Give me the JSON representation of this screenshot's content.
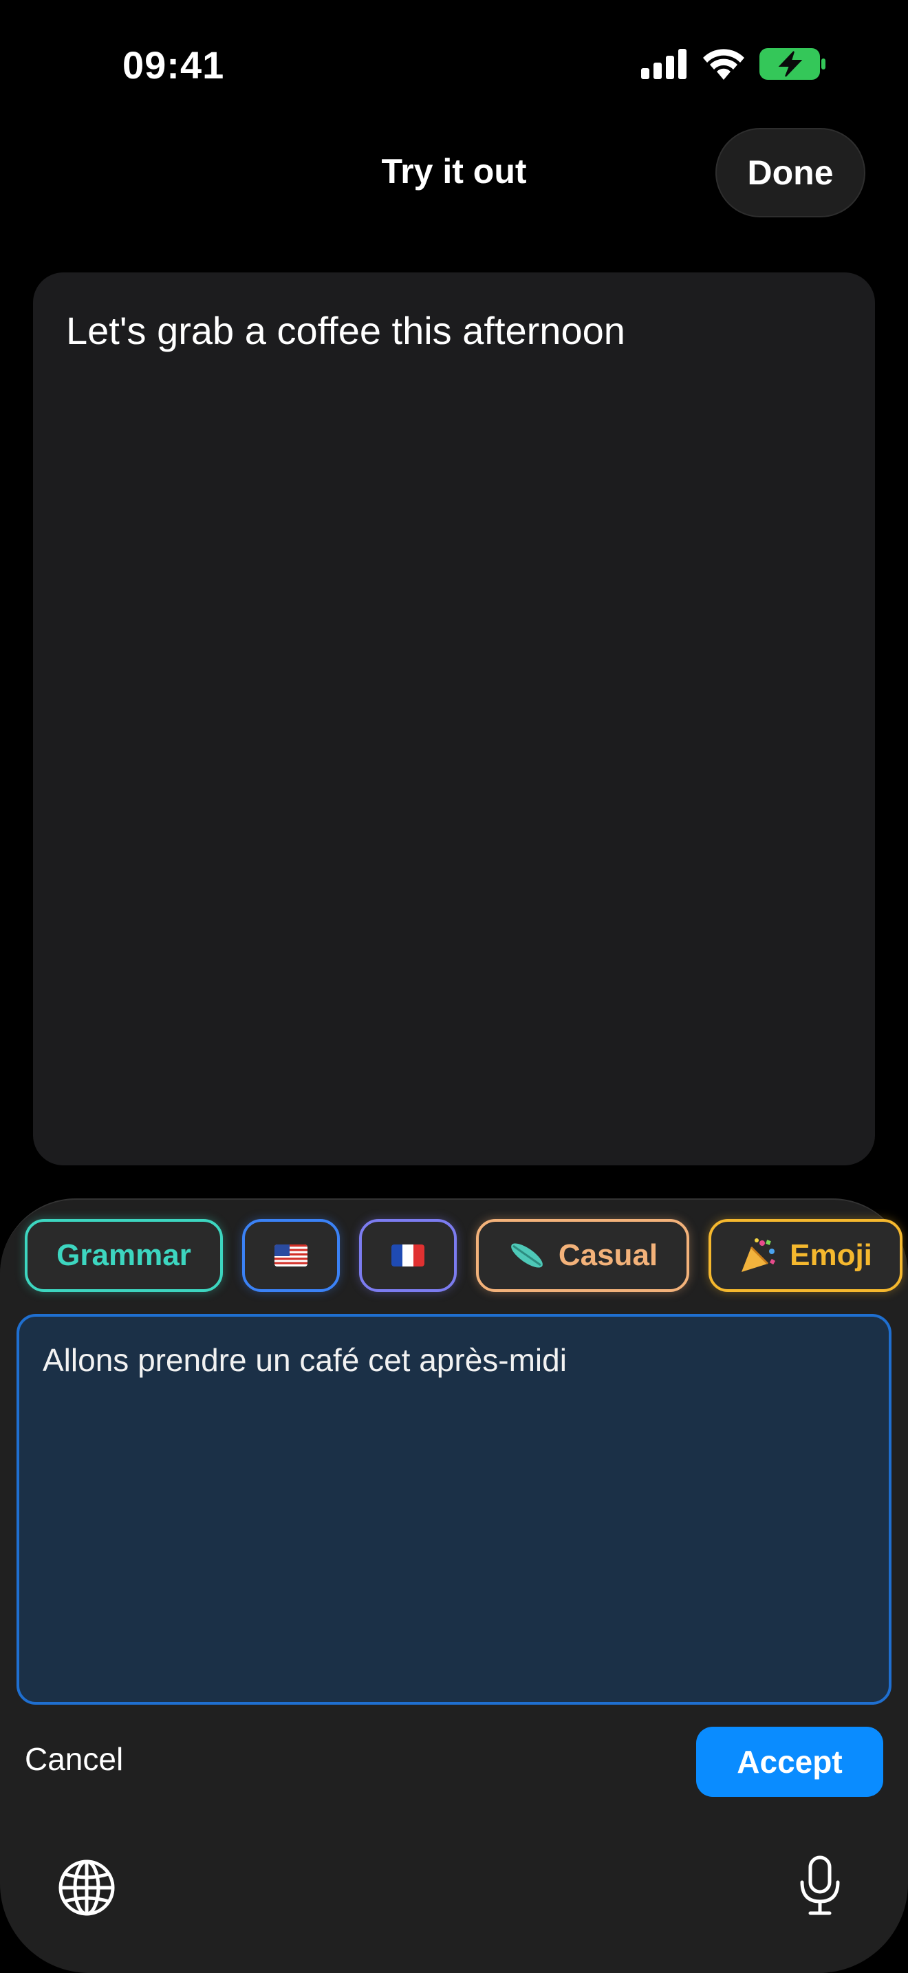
{
  "status_bar": {
    "time": "09:41",
    "icons": [
      "cellular-signal-icon",
      "wifi-icon",
      "battery-charging-icon"
    ],
    "battery_color": "#34c759"
  },
  "nav": {
    "title": "Try it out",
    "done_label": "Done"
  },
  "editor": {
    "text": "Let's grab a coffee this afternoon"
  },
  "chips": {
    "grammar": {
      "label": "Grammar",
      "color": "#3dd6c0"
    },
    "english": {
      "icon": "us-flag-icon",
      "color": "#3b82f6"
    },
    "french": {
      "icon": "french-flag-icon",
      "color": "#7c7cf0"
    },
    "casual": {
      "label": "Casual",
      "icon": "surfboard-icon",
      "color": "#f3b27a"
    },
    "emoji": {
      "label": "Emoji",
      "icon": "party-popper-icon",
      "color": "#f5b82e"
    }
  },
  "result": {
    "text": "Allons prendre un café cet après-midi"
  },
  "actions": {
    "cancel_label": "Cancel",
    "accept_label": "Accept",
    "accent": "#0a8cff"
  },
  "keyboard_bar": {
    "icons": [
      "globe-icon",
      "microphone-icon"
    ]
  }
}
